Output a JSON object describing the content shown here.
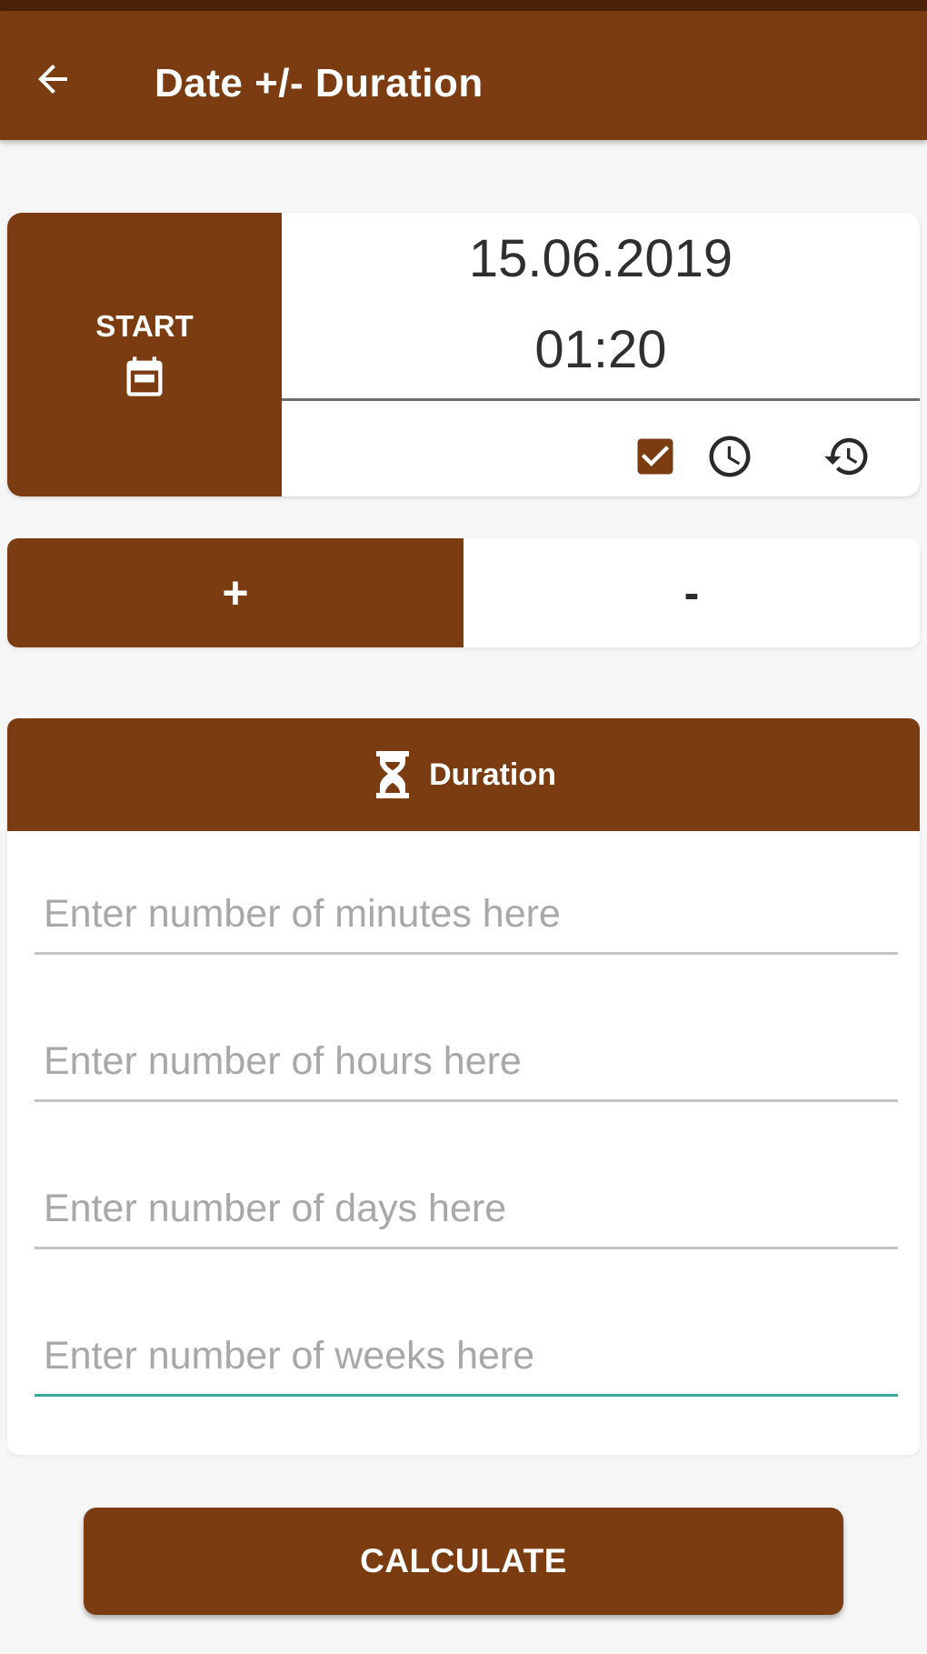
{
  "colors": {
    "primary": "#7a3c10",
    "status_bar": "#4b2208",
    "background": "#f6f6f6",
    "accent": "#3aa89a"
  },
  "appbar": {
    "back_icon": "arrow-left-icon",
    "title": "Date +/- Duration"
  },
  "start": {
    "label": "START",
    "icon": "calendar-icon",
    "date": "15.06.2019",
    "time": "01:20",
    "actions": [
      "checkbox-checked-icon",
      "clock-icon",
      "history-icon"
    ]
  },
  "operation": {
    "plus_label": "+",
    "minus_label": "-",
    "selected": "+"
  },
  "duration": {
    "icon": "hourglass-icon",
    "title": "Duration",
    "fields": [
      {
        "placeholder": "Enter number of minutes here",
        "value": ""
      },
      {
        "placeholder": "Enter number of hours here",
        "value": ""
      },
      {
        "placeholder": "Enter number of days here",
        "value": ""
      },
      {
        "placeholder": "Enter number of weeks here",
        "value": ""
      }
    ]
  },
  "calculate_label": "CALCULATE"
}
